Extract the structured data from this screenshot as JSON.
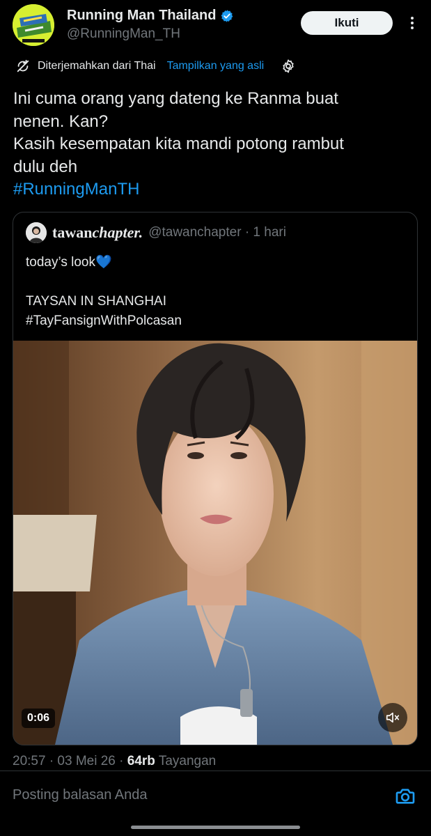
{
  "author": {
    "display_name": "Running Man Thailand",
    "handle": "@RunningMan_TH",
    "verified": true,
    "avatar_lettering": "RUNNING MAN THAILAND"
  },
  "follow_label": "Ikuti",
  "translation": {
    "label": "Diterjemahkan dari Thai",
    "show_original": "Tampilkan yang asli"
  },
  "tweet": {
    "text": "Ini cuma orang yang dateng ke Ranma buat\nnenen. Kan?\nKasih kesempatan kita mandi potong rambut\ndulu deh",
    "hashtag": "#RunningManTH"
  },
  "quote": {
    "name_part1": "tawan",
    "name_part2": "chapter.",
    "handle_time": "@tawanchapter · 1 hari",
    "text": "today’s look💙\n\nTAYSAN IN SHANGHAI\n#TayFansignWithPolcasan",
    "video_duration": "0:06"
  },
  "meta": {
    "time_date": "20:57 · 03 Mei 26 · ",
    "views_count": "64rb",
    "views_label": " Tayangan"
  },
  "reply": {
    "placeholder": "Posting balasan Anda"
  },
  "colors": {
    "background": "#000000",
    "accent": "#1d9bf0",
    "secondary_text": "#71767b",
    "follow_button": "#eff3f4"
  },
  "icons": {
    "verified": "verified-badge-icon",
    "more": "more-vertical-icon",
    "translate": "translate-icon",
    "settings": "gear-icon",
    "mute": "speaker-muted-icon",
    "camera": "camera-icon"
  }
}
